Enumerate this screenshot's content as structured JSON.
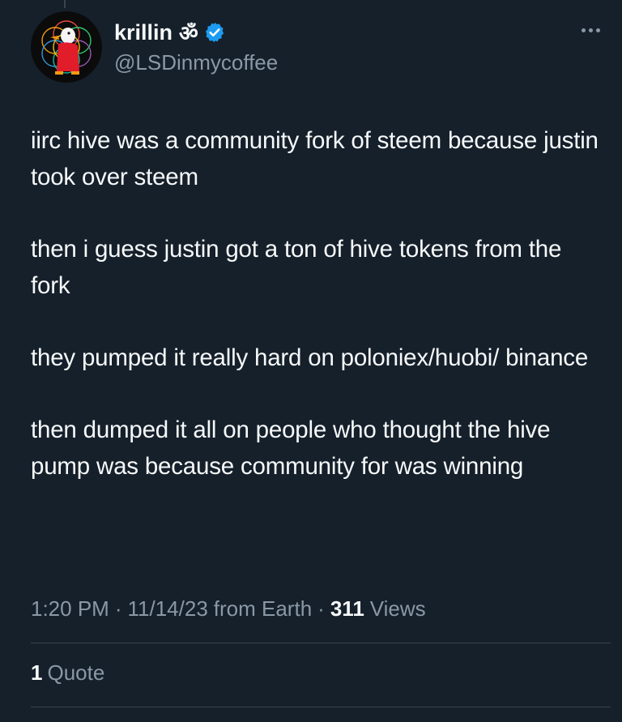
{
  "tweet": {
    "author": {
      "display_name": "krillin",
      "name_emoji": "ॐ",
      "handle": "@LSDinmycoffee",
      "verified": true,
      "avatar_icon": "duck-avatar-icon"
    },
    "paragraphs": [
      "iirc hive was a community fork of steem because justin took over steem",
      "then i guess justin got a ton of hive tokens from the fork",
      "they pumped it really hard on poloniex/huobi/ binance",
      "then dumped it all on people who thought the hive pump was because community for was winning"
    ],
    "time": "1:20 PM",
    "date": "11/14/23",
    "source": "from Earth",
    "separator": "·",
    "views_count": "311",
    "views_label": "Views",
    "quote_count": "1",
    "quote_label": "Quote"
  },
  "colors": {
    "background": "#15202b",
    "text": "#f7f9f9",
    "secondary": "#8b98a5",
    "verified_blue": "#1d9bf0",
    "divider": "#38444d"
  }
}
